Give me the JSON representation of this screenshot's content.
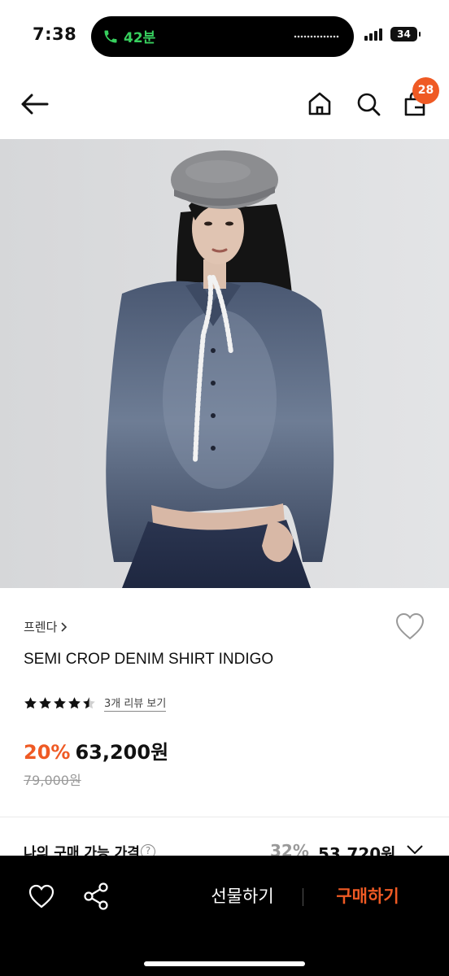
{
  "status_bar": {
    "time": "7:38",
    "call_duration": "42분",
    "battery": "34"
  },
  "header": {
    "cart_count": "28"
  },
  "product": {
    "brand": "프렌다",
    "name": "SEMI CROP DENIM SHIRT INDIGO",
    "rating": 4.5,
    "review_link": "3개 리뷰 보기",
    "discount": "20%",
    "price": "63,200원",
    "original_price": "79,000원"
  },
  "my_price": {
    "label": "나의 구매 가능 가격",
    "discount": "32%",
    "price": "53,720원"
  },
  "bottom_bar": {
    "gift_label": "선물하기",
    "buy_label": "구매하기"
  },
  "colors": {
    "accent": "#ef5a24",
    "call_green": "#37d05e"
  }
}
